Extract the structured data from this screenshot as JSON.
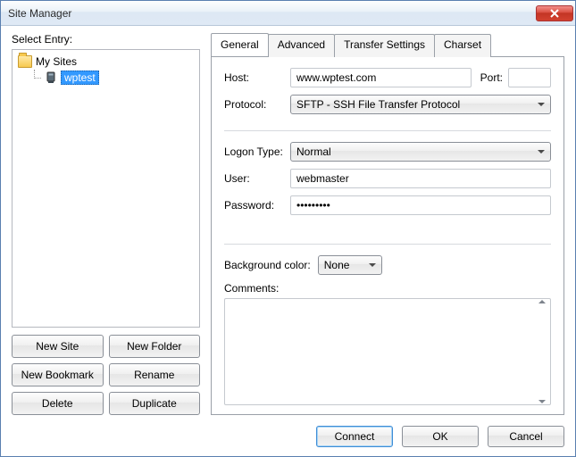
{
  "window": {
    "title": "Site Manager"
  },
  "left": {
    "select_label": "Select Entry:",
    "root_label": "My Sites",
    "site_label": "wptest",
    "buttons": {
      "new_site": "New Site",
      "new_folder": "New Folder",
      "new_bookmark": "New Bookmark",
      "rename": "Rename",
      "delete": "Delete",
      "duplicate": "Duplicate"
    }
  },
  "tabs": {
    "general": "General",
    "advanced": "Advanced",
    "transfer": "Transfer Settings",
    "charset": "Charset"
  },
  "form": {
    "host_label": "Host:",
    "host_value": "www.wptest.com",
    "port_label": "Port:",
    "port_value": "",
    "protocol_label": "Protocol:",
    "protocol_value": "SFTP - SSH File Transfer Protocol",
    "logon_label": "Logon Type:",
    "logon_value": "Normal",
    "user_label": "User:",
    "user_value": "webmaster",
    "password_label": "Password:",
    "password_value": "•••••••••",
    "bgcolor_label": "Background color:",
    "bgcolor_value": "None",
    "comments_label": "Comments:"
  },
  "footer": {
    "connect": "Connect",
    "ok": "OK",
    "cancel": "Cancel"
  }
}
